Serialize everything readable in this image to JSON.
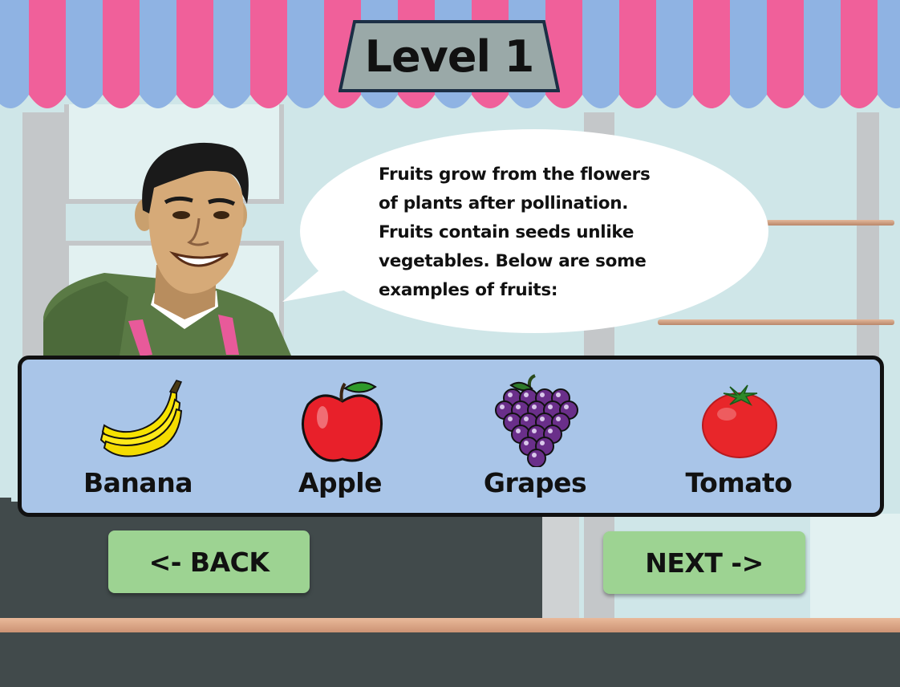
{
  "title": "Level 1",
  "speech": {
    "lines": [
      "Fruits grow from the flowers",
      "of plants after pollination.",
      "Fruits contain seeds unlike",
      "vegetables. Below are some",
      "examples of fruits:"
    ]
  },
  "fruits": [
    {
      "label": "Banana",
      "icon": "banana-icon"
    },
    {
      "label": "Apple",
      "icon": "apple-icon"
    },
    {
      "label": "Grapes",
      "icon": "grapes-icon"
    },
    {
      "label": "Tomato",
      "icon": "tomato-icon"
    }
  ],
  "buttons": {
    "back_label": "<- BACK",
    "next_label": "NEXT ->"
  },
  "colors": {
    "awning_pink": "#f0609a",
    "awning_blue": "#8fb3e3",
    "panel_bg": "#a9c5e8",
    "button_green": "#9dd392",
    "plaque_bg": "#9aa9a8",
    "plaque_border": "#1c2f45"
  }
}
